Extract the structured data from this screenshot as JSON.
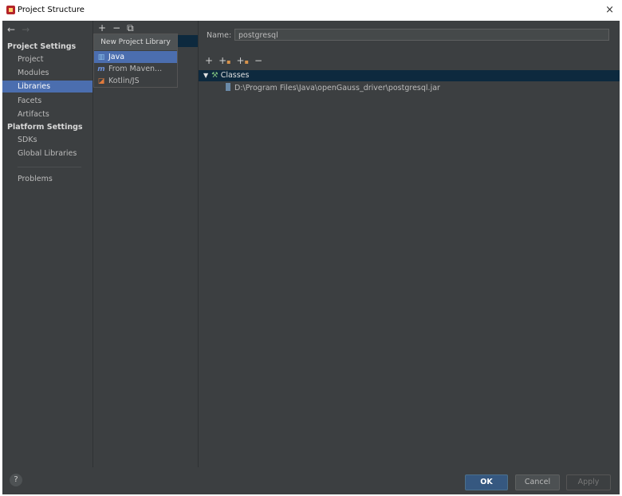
{
  "window": {
    "title": "Project Structure",
    "close_glyph": "×"
  },
  "nav": {
    "back": "←",
    "forward": "→"
  },
  "sidebar": {
    "project_settings_heading": "Project Settings",
    "project_items": [
      "Project",
      "Modules",
      "Libraries",
      "Facets",
      "Artifacts"
    ],
    "platform_settings_heading": "Platform Settings",
    "platform_items": [
      "SDKs",
      "Global Libraries"
    ],
    "problems": "Problems",
    "selected": "Libraries"
  },
  "libraries_toolbar": {
    "add": "+",
    "remove": "−",
    "copy": "⧉"
  },
  "popup": {
    "title": "New Project Library",
    "items": [
      {
        "label": "Java",
        "icon": "java-library-icon"
      },
      {
        "label": "From Maven...",
        "icon": "maven-icon"
      },
      {
        "label": "Kotlin/JS",
        "icon": "kotlin-js-icon"
      }
    ]
  },
  "details": {
    "name_label": "Name:",
    "name_value": "postgresql",
    "toolbar": {
      "add": "+",
      "add_classes": "+",
      "add_js": "+",
      "remove": "−"
    },
    "classes_label": "Classes",
    "jar_path": "D:\\Program Files\\Java\\openGauss_driver\\postgresql.jar"
  },
  "buttons": {
    "help": "?",
    "ok": "OK",
    "cancel": "Cancel",
    "apply": "Apply"
  },
  "colors": {
    "background": "#3c3f41",
    "selection": "#4b6eaf",
    "accent": "#365880"
  }
}
